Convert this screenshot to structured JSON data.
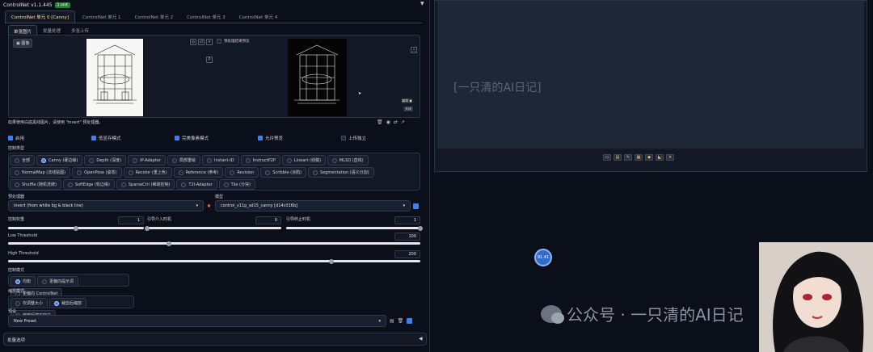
{
  "header": {
    "title": "ControlNet v1.1.445",
    "badge": "1 unit"
  },
  "units": [
    "ControlNet 单元 0 [Canny]",
    "ControlNet 单元 1",
    "ControlNet 单元 2",
    "ControlNet 单元 3",
    "ControlNet 单元 4"
  ],
  "subtabs": [
    "单张图片",
    "批量处理",
    "多张上传"
  ],
  "image_area": {
    "label": "图像",
    "preview_label": "预处理结果预览",
    "hint": "如果使用白底黑线图片，请使用 \"invert\" 预处理器。"
  },
  "checks": {
    "enable": "启用",
    "lowvram": "低显存模式",
    "pixel_perfect": "完美像素模式",
    "allow_preview": "允许预览",
    "upload_independent": "上传独立"
  },
  "control_type": {
    "label": "控制类型",
    "options": [
      "全部",
      "Canny (硬边缘)",
      "Depth (深度)",
      "IP-Adapter",
      "局部重绘",
      "Instant-ID",
      "InstructP2P",
      "Lineart (线稿)",
      "MLSD (直线)",
      "NormalMap (法线贴图)",
      "OpenPose (姿态)",
      "Recolor (重上色)",
      "Reference (参考)",
      "Revision",
      "Scribble (涂鸦)",
      "Segmentation (语义分割)",
      "Shuffle (随机洗牌)",
      "SoftEdge (软边缘)",
      "SparseCtrl (稀疏控制)",
      "T2I-Adapter",
      "Tile (分块)"
    ],
    "selected": "Canny (硬边缘)"
  },
  "preprocessor": {
    "label": "预处理器",
    "value": "invert (from white bg & black line)"
  },
  "model": {
    "label": "模型",
    "value": "control_v11p_sd15_canny [d14c016b]"
  },
  "sliders": {
    "weight_label": "控制权重",
    "weight": 1,
    "start_label": "引导介入时机",
    "start": 0,
    "end_label": "引导终止时机",
    "end": 1,
    "low_label": "Low Threshold",
    "low": 100,
    "high_label": "High Threshold",
    "high": 200
  },
  "control_mode": {
    "label": "控制模式",
    "options": [
      "均衡",
      "更偏向提示词",
      "更偏向 ControlNet"
    ],
    "selected": "均衡"
  },
  "resize_mode": {
    "label": "缩放模式",
    "options": [
      "仅调整大小",
      "裁剪后缩放",
      "缩放后填充空白"
    ],
    "selected": "裁剪后缩放"
  },
  "preset": {
    "label": "预设",
    "value": "New Preset"
  },
  "batch": {
    "label": "批量选项"
  },
  "output": {
    "caption": "[一只清的AI日记]",
    "float_button": "91.41"
  },
  "watermark": {
    "text": "公众号 · 一只清的AI日记"
  },
  "colors": {
    "accent": "#3b82f6",
    "tab_active": "#ffe08a",
    "badge": "#1f8a36"
  }
}
